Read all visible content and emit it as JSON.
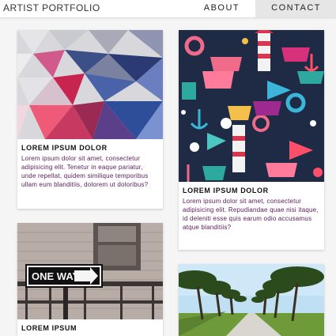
{
  "header": {
    "brand": "ARTIST PORTFOLIO",
    "nav": [
      {
        "label": "ABOUT",
        "active": false
      },
      {
        "label": "CONTACT",
        "active": true
      }
    ]
  },
  "cards": [
    {
      "image": "low-poly-geometric-art",
      "title": "LOREM IPSUM DOLOR",
      "text": "Lorem ipsum dolor sit amet, consectetur adipisicing elit. Tenetur in eaque pariatur, unde repellat, quidem similique temporibus ullam eum blanditiis, dolorem ut doloribus?"
    },
    {
      "image": "nautical-pattern-illustration",
      "title": "LOREM IPSUM DOLOR",
      "text": "Lorem ipsum dolor sit amet, consectetur adipisicing elit. Repudiandae quae nisi itaque, id deleniti esse quis earum odio accusamus atque blanditiis?"
    },
    {
      "image": "one-way-street-sign-photo",
      "title": "LOREM IPSUM",
      "sign_text": "ONE WAY"
    },
    {
      "image": "tree-lined-road-photo"
    }
  ],
  "colors": {
    "text_accent": "#5a1a5a",
    "nav_active_bg": "#e6e6e6",
    "pattern_bg": "#1f2a44"
  }
}
